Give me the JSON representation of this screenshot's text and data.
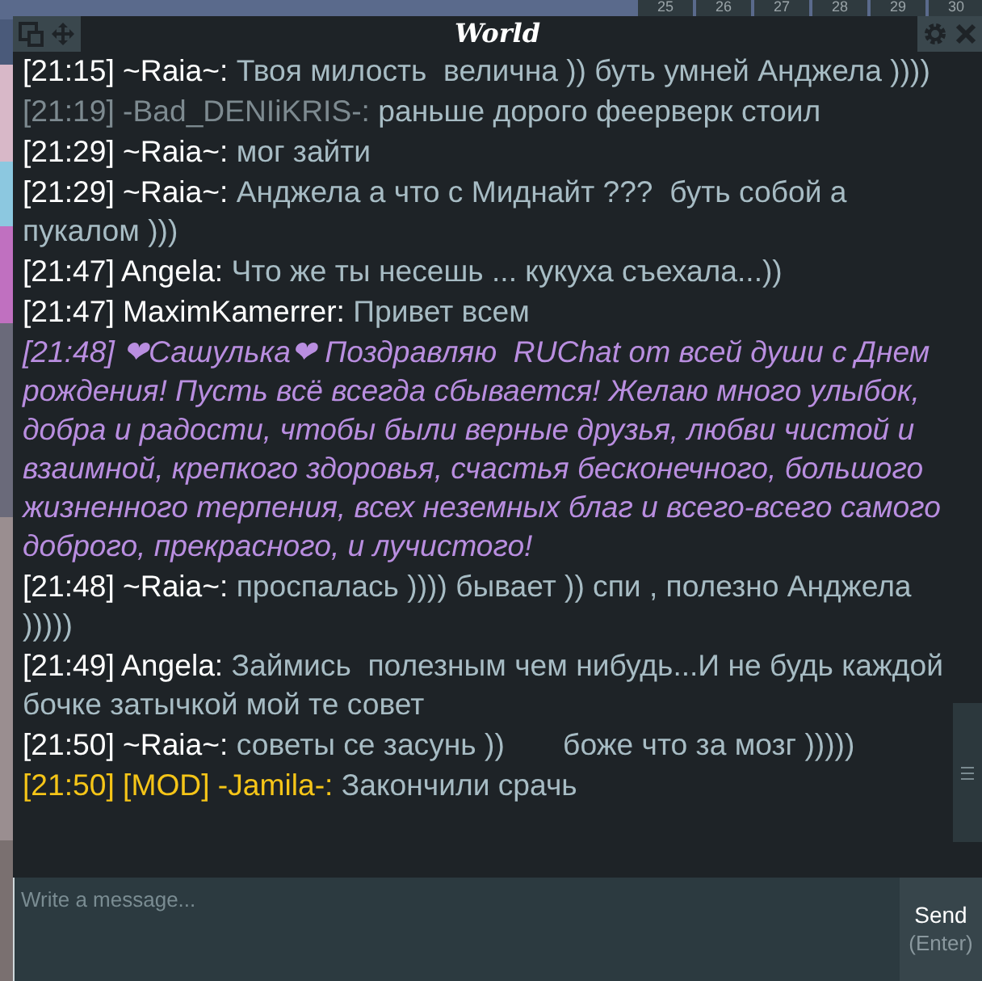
{
  "background_tiles": [
    "25",
    "26",
    "27",
    "28",
    "29",
    "30"
  ],
  "window": {
    "title": "World"
  },
  "messages": [
    {
      "kind": "normal",
      "time": "[21:15]",
      "author": "~Raia~:",
      "text": "Твоя милость  велична )) буть умней Анджела ))))"
    },
    {
      "kind": "dimmed",
      "time": "[21:19]",
      "author": "-Bad_DENIiKRIS-:",
      "text": "раньше дорого феерверк стоил"
    },
    {
      "kind": "normal",
      "time": "[21:29]",
      "author": "~Raia~:",
      "text": "мог зайти"
    },
    {
      "kind": "normal",
      "time": "[21:29]",
      "author": "~Raia~:",
      "text": "Анджела а что с Миднайт ???  буть собой а пукалом )))"
    },
    {
      "kind": "normal",
      "time": "[21:47]",
      "author": "Angela:",
      "text": "Что же ты несешь ... кукуха съехала...))"
    },
    {
      "kind": "normal",
      "time": "[21:47]",
      "author": "MaximKamerrer:",
      "text": "Привет всем"
    },
    {
      "kind": "emote",
      "time": "[21:48]",
      "author": "❤Сашулька❤",
      "text": "Поздравляю  RUChat от всей души с Днем рождения! Пусть всё всегда сбывается! Желаю много улыбок, добра и радости, чтобы были верные друзья, любви чистой и взаимной, крепкого здоровья, счастья бесконечного, большого жизненного терпения, всех неземных благ и всего-всего самого доброго, прекрасного, и лучистого!"
    },
    {
      "kind": "normal",
      "time": "[21:48]",
      "author": "~Raia~:",
      "text": "проспалась )))) бывает )) спи , полезно Анджела )))))"
    },
    {
      "kind": "normal",
      "time": "[21:49]",
      "author": "Angela:",
      "text": "Займись  полезным чем нибудь...И не будь каждой бочке затычкой мой те совет"
    },
    {
      "kind": "normal",
      "time": "[21:50]",
      "author": "~Raia~:",
      "text": "советы се засунь ))       боже что за мозг )))))"
    },
    {
      "kind": "mod",
      "time": "[21:50]",
      "author": "[MOD] -Jamila-:",
      "text": "Закончили срачь"
    }
  ],
  "composer": {
    "placeholder": "Write a message...",
    "send_label": "Send",
    "send_hint": "(Enter)"
  }
}
